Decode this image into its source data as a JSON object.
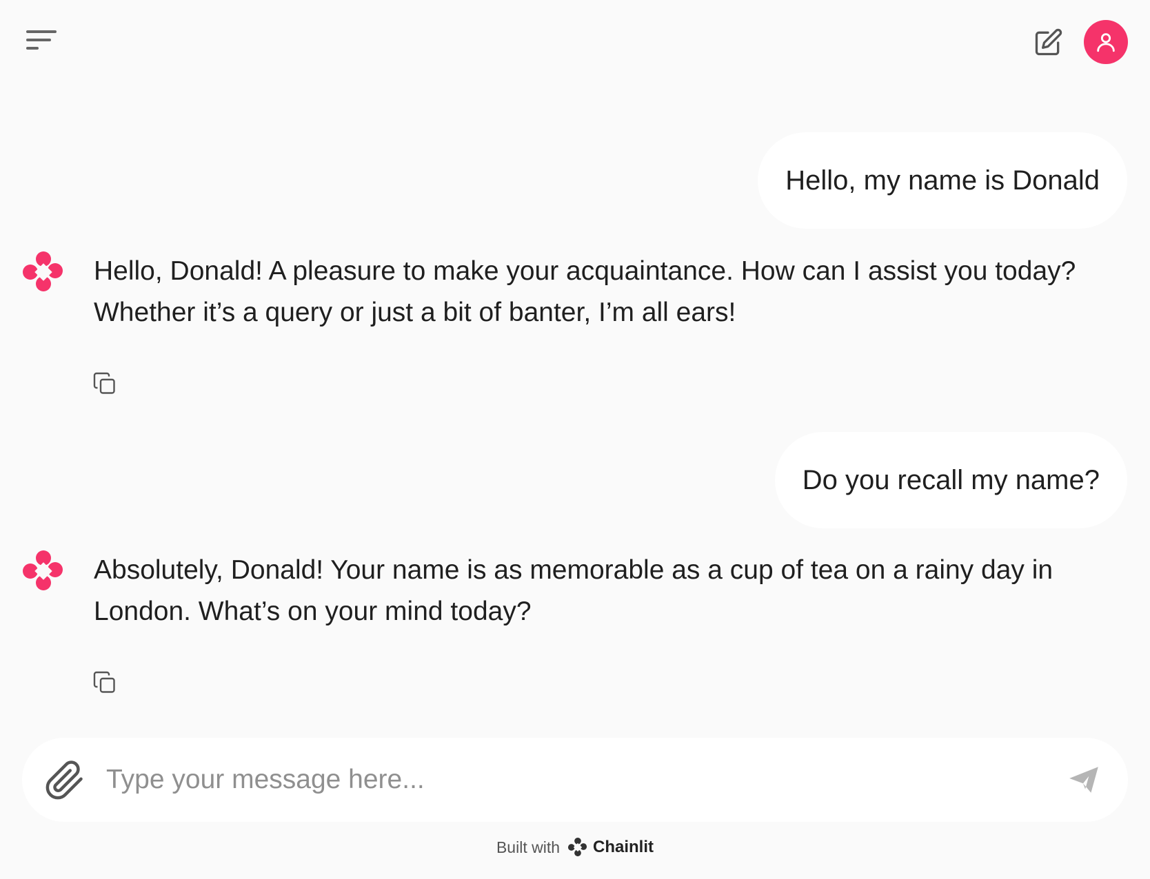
{
  "header": {
    "menu_icon": "menu-lines-icon",
    "new_chat_icon": "edit-pencil-icon",
    "avatar_icon": "user-icon",
    "accent_color": "#f5336a"
  },
  "messages": [
    {
      "role": "user",
      "text": "Hello, my name is Donald"
    },
    {
      "role": "assistant",
      "text": "Hello, Donald! A pleasure to make your acquaintance. How can I assist you today? Whether it’s a query or just a bit of banter, I’m all ears!"
    },
    {
      "role": "user",
      "text": "Do you recall my name?"
    },
    {
      "role": "assistant",
      "text": "Absolutely, Donald! Your name is as memorable as a cup of tea on a rainy day in London. What’s on your mind today?"
    }
  ],
  "composer": {
    "placeholder": "Type your message here...",
    "value": "",
    "attach_icon": "paperclip-icon",
    "send_icon": "send-icon"
  },
  "footer": {
    "built_with": "Built with",
    "brand": "Chainlit"
  }
}
